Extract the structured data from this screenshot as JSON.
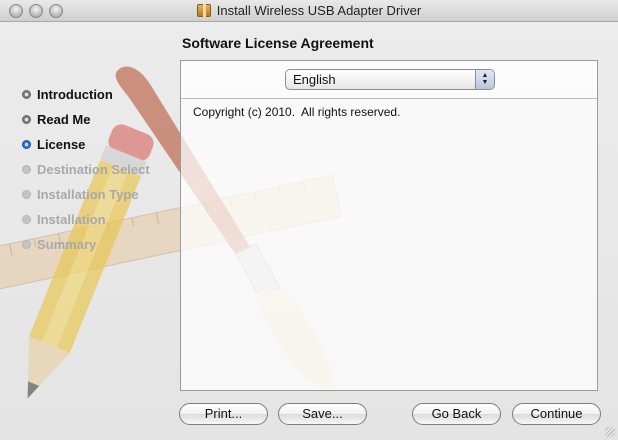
{
  "window": {
    "title": "Install Wireless USB Adapter Driver"
  },
  "heading": "Software License Agreement",
  "steps": [
    {
      "label": "Introduction",
      "state": "done"
    },
    {
      "label": "Read Me",
      "state": "done"
    },
    {
      "label": "License",
      "state": "current"
    },
    {
      "label": "Destination Select",
      "state": "pending"
    },
    {
      "label": "Installation Type",
      "state": "pending"
    },
    {
      "label": "Installation",
      "state": "pending"
    },
    {
      "label": "Summary",
      "state": "pending"
    }
  ],
  "language_select": {
    "value": "English"
  },
  "license_text": "Copyright (c) 2010.  All rights reserved.",
  "buttons": {
    "print": "Print...",
    "save": "Save...",
    "go_back": "Go Back",
    "continue": "Continue"
  },
  "icons": {
    "title_icon": "installer-package-icon",
    "select_arrows": "up-down-arrows-icon"
  },
  "colors": {
    "current_step_dot": "#2d6fd0",
    "pending_text": "#a9a9a9"
  }
}
